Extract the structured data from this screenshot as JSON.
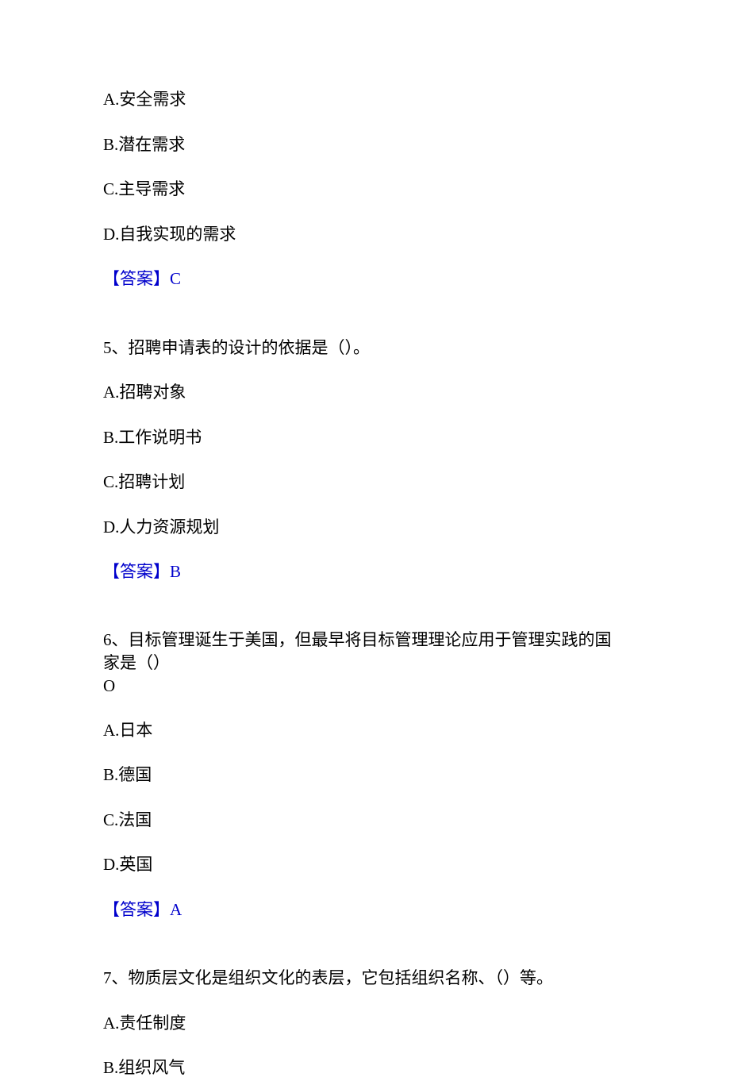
{
  "questions": [
    {
      "option_a": "A.安全需求",
      "option_b": "B.潜在需求",
      "option_c": "C.主导需求",
      "option_d": "D.自我实现的需求",
      "answer_label": "【答案】",
      "answer_value": "C"
    },
    {
      "text": "5、招聘申请表的设计的依据是（）。",
      "option_a": "A.招聘对象",
      "option_b": "B.工作说明书",
      "option_c": "C.招聘计划",
      "option_d": "D.人力资源规划",
      "answer_label": "【答案】",
      "answer_value": "B"
    },
    {
      "text_line1": "6、目标管理诞生于美国，但最早将目标管理理论应用于管理实践的国家是（）",
      "text_line2": "O",
      "option_a": "A.日本",
      "option_b": "B.德国",
      "option_c": "C.法国",
      "option_d": "D.英国",
      "answer_label": "【答案】",
      "answer_value": "A"
    },
    {
      "text": "7、物质层文化是组织文化的表层，它包括组织名称、（）等。",
      "option_a": "A.责任制度",
      "option_b": "B.组织风气"
    }
  ]
}
